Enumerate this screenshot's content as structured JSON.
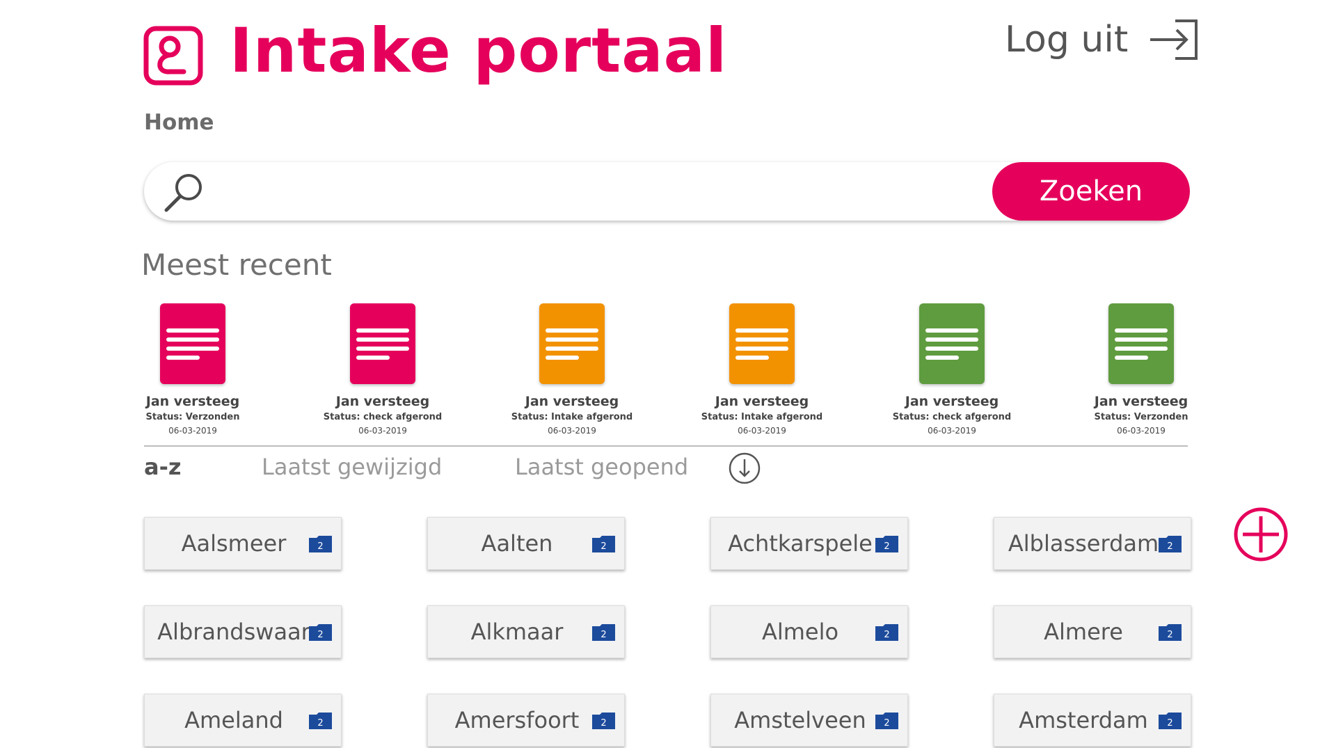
{
  "header": {
    "title": "Intake portaal",
    "logout_label": "Log uit",
    "accent_color": "#e5005b",
    "logo_icon": "logo-icon",
    "logout_icon": "logout-arrow-icon"
  },
  "breadcrumb": {
    "home": "Home"
  },
  "search": {
    "value": "",
    "placeholder": "",
    "button_label": "Zoeken",
    "icon": "search-icon"
  },
  "recent": {
    "title": "Meest recent",
    "items": [
      {
        "name": "Jan versteeg",
        "status": "Status: Verzonden",
        "date": "06-03-2019",
        "color": "#e5005b"
      },
      {
        "name": "Jan versteeg",
        "status": "Status: check afgerond",
        "date": "06-03-2019",
        "color": "#e5005b"
      },
      {
        "name": "Jan versteeg",
        "status": "Status: Intake afgerond",
        "date": "06-03-2019",
        "color": "#f39200"
      },
      {
        "name": "Jan versteeg",
        "status": "Status: Intake afgerond",
        "date": "06-03-2019",
        "color": "#f39200"
      },
      {
        "name": "Jan versteeg",
        "status": "Status: check afgerond",
        "date": "06-03-2019",
        "color": "#5f9c3f"
      },
      {
        "name": "Jan versteeg",
        "status": "Status: Verzonden",
        "date": "06-03-2019",
        "color": "#5f9c3f"
      }
    ]
  },
  "sort": {
    "tabs": [
      "a-z",
      "Laatst gewijzigd",
      "Laatst geopend"
    ],
    "active": "a-z",
    "direction_icon": "arrow-down-circle-icon"
  },
  "municipalities": [
    {
      "name": "Aalsmeer",
      "count": "2"
    },
    {
      "name": "Aalten",
      "count": "2"
    },
    {
      "name": "Achtkarspele",
      "count": "2"
    },
    {
      "name": "Alblasserdam",
      "count": "2"
    },
    {
      "name": "Albrandswaar",
      "count": "2"
    },
    {
      "name": "Alkmaar",
      "count": "2"
    },
    {
      "name": "Almelo",
      "count": "2"
    },
    {
      "name": "Almere",
      "count": "2"
    },
    {
      "name": "Ameland",
      "count": "2"
    },
    {
      "name": "Amersfoort",
      "count": "2"
    },
    {
      "name": "Amstelveen",
      "count": "2"
    },
    {
      "name": "Amsterdam",
      "count": "2"
    }
  ],
  "colors": {
    "folder": "#1c4b9c",
    "text": "#555555"
  },
  "add_icon": "plus-circle-icon"
}
